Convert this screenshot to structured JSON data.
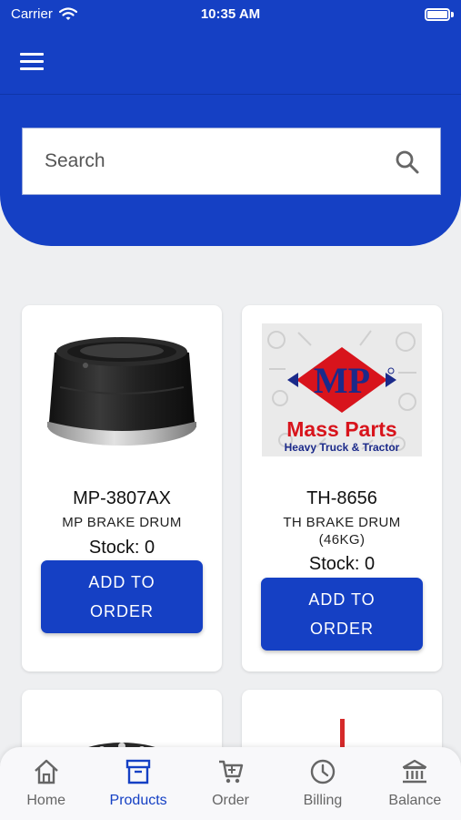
{
  "status_bar": {
    "carrier": "Carrier",
    "time": "10:35 AM"
  },
  "search": {
    "placeholder": "Search"
  },
  "products": [
    {
      "code": "MP-3807AX",
      "name": "MP BRAKE DRUM",
      "stock_label": "Stock: 0",
      "button_label": "ADD TO ORDER"
    },
    {
      "code": "TH-8656",
      "name": "TH BRAKE DRUM (46KG)",
      "stock_label": "Stock: 0",
      "button_label": "ADD TO ORDER",
      "logo": {
        "brand_initials": "MP",
        "brand_name": "Mass Parts",
        "tagline": "Heavy Truck & Tractor"
      }
    }
  ],
  "bottom_nav": {
    "active": "Products",
    "items": [
      {
        "label": "Home",
        "icon": "home-icon"
      },
      {
        "label": "Products",
        "icon": "archive-box-icon"
      },
      {
        "label": "Order",
        "icon": "cart-icon"
      },
      {
        "label": "Billing",
        "icon": "clock-icon"
      },
      {
        "label": "Balance",
        "icon": "bank-icon"
      }
    ]
  },
  "colors": {
    "primary": "#1540c4",
    "background": "#eeeff1",
    "inactive_nav": "#666666"
  }
}
